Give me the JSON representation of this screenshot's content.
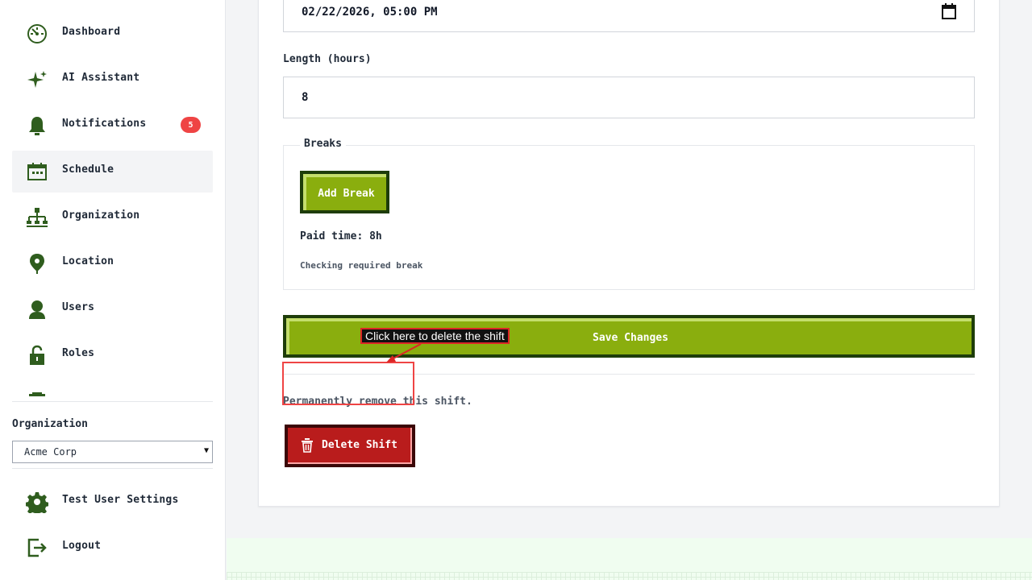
{
  "sidebar": {
    "items": [
      {
        "label": "Dashboard",
        "icon": "dashboard-icon"
      },
      {
        "label": "AI Assistant",
        "icon": "sparkle-icon"
      },
      {
        "label": "Notifications",
        "icon": "bell-icon",
        "badge": "5"
      },
      {
        "label": "Schedule",
        "icon": "calendar-icon",
        "active": true
      },
      {
        "label": "Organization",
        "icon": "org-chart-icon"
      },
      {
        "label": "Location",
        "icon": "map-pin-icon"
      },
      {
        "label": "Users",
        "icon": "user-icon"
      },
      {
        "label": "Roles",
        "icon": "lock-icon"
      }
    ],
    "org_label": "Organization",
    "org_selected": "Acme Corp",
    "bottom_items": [
      {
        "label": "Test User Settings",
        "icon": "gear-icon"
      },
      {
        "label": "Logout",
        "icon": "logout-icon"
      }
    ]
  },
  "form": {
    "start_value": "02/22/2026, 05:00 PM",
    "length_label": "Length (hours)",
    "length_value": "8",
    "breaks_legend": "Breaks",
    "add_break_label": "Add Break",
    "paid_time": "Paid time: 8h",
    "checking_text": "Checking required break",
    "save_label": "Save Changes",
    "delete_description": "Permanently remove this shift.",
    "delete_label": "Delete Shift"
  },
  "annotation": {
    "hint_text": "Click here to delete the shift"
  },
  "colors": {
    "brand_green": "#8aae0e",
    "brand_dark": "#1e3d0a",
    "danger": "#b91c1c",
    "badge": "#ef4444",
    "icon_green": "#2f5d1e"
  }
}
